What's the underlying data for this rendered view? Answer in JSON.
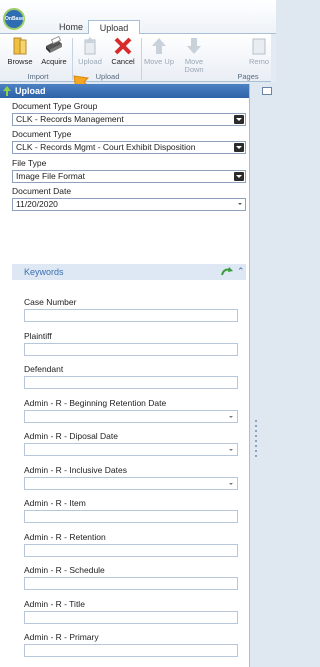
{
  "app": {
    "logo_text": "OnBase"
  },
  "tabs": [
    {
      "label": "Home"
    },
    {
      "label": "Upload"
    }
  ],
  "ribbon": {
    "buttons": {
      "browse": "Browse",
      "acquire": "Acquire",
      "upload": "Upload",
      "cancel": "Cancel",
      "move_up": "Move Up",
      "move_down": "Move Down",
      "remove": "Remo"
    },
    "groups": {
      "import": "Import",
      "upload": "Upload",
      "pages": "Pages"
    }
  },
  "panel": {
    "title": "Upload",
    "fields": {
      "doc_type_group_label": "Document Type Group",
      "doc_type_group_value": "CLK - Records Management",
      "doc_type_label": "Document Type",
      "doc_type_value": "CLK - Records Mgmt - Court Exhibit Disposition",
      "file_type_label": "File Type",
      "file_type_value": "Image File Format",
      "doc_date_label": "Document Date",
      "doc_date_value": "11/20/2020"
    },
    "keywords": {
      "title": "Keywords",
      "items": [
        "Case Number",
        "Plaintiff",
        "Defendant",
        "Admin - R - Beginning Retention Date",
        "Admin - R - Diposal Date",
        "Admin - R - Inclusive Dates",
        "Admin - R - Item",
        "Admin - R - Retention",
        "Admin - R - Schedule",
        "Admin - R - Title",
        "Admin - R - Primary"
      ]
    }
  },
  "colors": {
    "header_blue": "#2e62a7",
    "accent_orange": "#f5a623",
    "cancel_red": "#d62c2c"
  }
}
